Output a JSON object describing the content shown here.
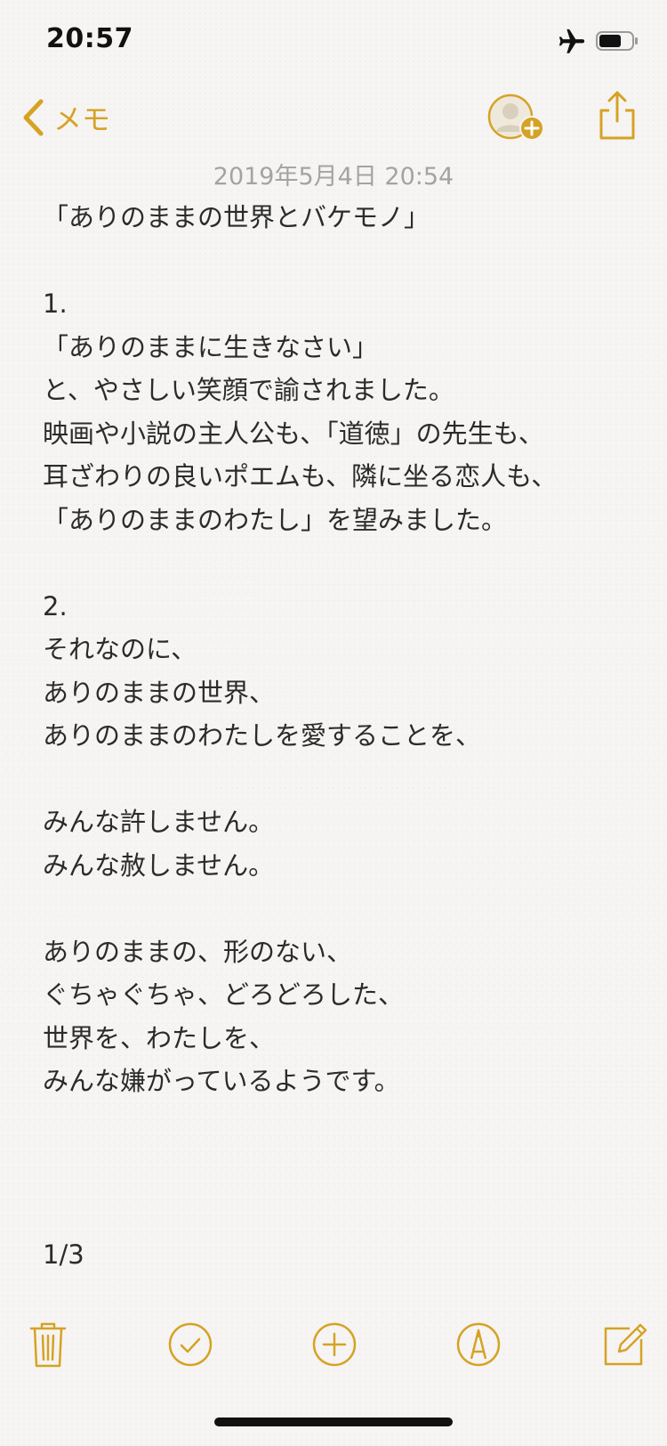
{
  "status_bar": {
    "time": "20:57",
    "icons": [
      "airplane-mode-icon",
      "battery-icon"
    ]
  },
  "nav": {
    "back_label": "メモ",
    "icons": [
      "chevron-left-icon",
      "add-person-icon",
      "share-icon"
    ]
  },
  "note": {
    "date": "2019年5月4日 20:54",
    "lines": [
      "「ありのままの世界とバケモノ」",
      "",
      "1.",
      "「ありのままに生きなさい」",
      "と、やさしい笑顔で諭されました。",
      "映画や小説の主人公も、「道徳」の先生も、",
      "耳ざわりの良いポエムも、隣に坐る恋人も、",
      "「ありのままのわたし」を望みました。",
      "",
      "2.",
      "それなのに、",
      "ありのままの世界、",
      "ありのままのわたしを愛することを、",
      "",
      "みんな許しません。",
      "みんな赦しません。",
      "",
      "ありのままの、形のない、",
      "ぐちゃぐちゃ、どろどろした、",
      "世界を、わたしを、",
      "みんな嫌がっているようです。"
    ],
    "page_indicator": "1/3"
  },
  "toolbar": {
    "icons": [
      "trash-icon",
      "checklist-icon",
      "add-icon",
      "markup-icon",
      "compose-icon"
    ]
  },
  "colors": {
    "accent": "#d6a225",
    "background": "#f6f5f3",
    "text": "#2b2b2b",
    "date": "#a3a3a3"
  }
}
